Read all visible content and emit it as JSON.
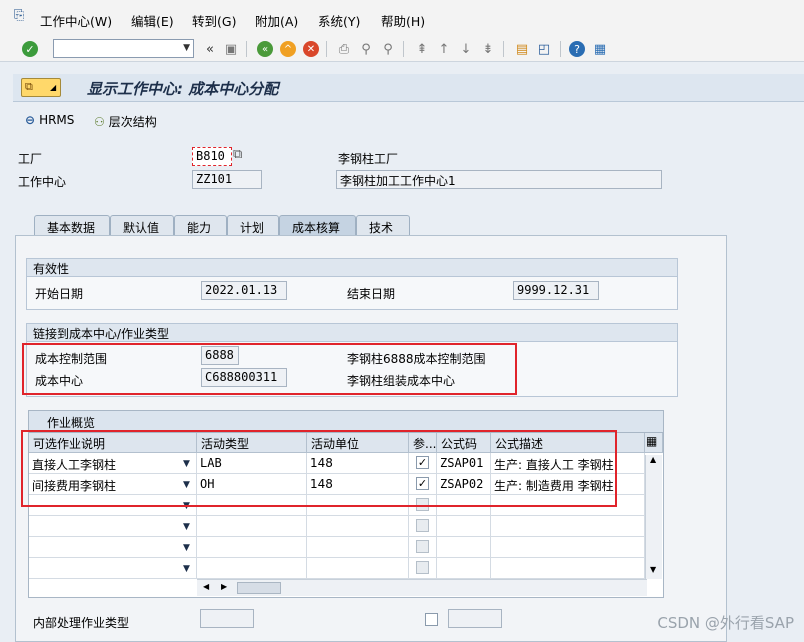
{
  "menu": [
    "工作中心(W)",
    "编辑(E)",
    "转到(G)",
    "附加(A)",
    "系统(Y)",
    "帮助(H)"
  ],
  "menu_underline": [
    "W",
    "E",
    "G",
    "A",
    "Y",
    "H"
  ],
  "title": "显示工作中心: 成本中心分配",
  "app_toolbar": {
    "hrms": "HRMS",
    "hierarchy": "层次结构"
  },
  "header": {
    "plant_label": "工厂",
    "plant_value": "B810",
    "plant_desc": "李钢柱工厂",
    "wc_label": "工作中心",
    "wc_value": "ZZ101",
    "wc_desc": "李钢柱加工工作中心1"
  },
  "tabs": [
    "基本数据",
    "默认值",
    "能力",
    "计划",
    "成本核算",
    "技术"
  ],
  "active_tab": "成本核算",
  "validity": {
    "title": "有效性",
    "start_label": "开始日期",
    "start_value": "2022.01.13",
    "end_label": "结束日期",
    "end_value": "9999.12.31"
  },
  "link": {
    "title": "链接到成本中心/作业类型",
    "ca_label": "成本控制范围",
    "ca_value": "6888",
    "ca_desc": "李钢柱6888成本控制范围",
    "cc_label": "成本中心",
    "cc_value": "C688800311",
    "cc_desc": "李钢柱组装成本中心"
  },
  "activity_table": {
    "title": "作业概览",
    "columns": [
      "可选作业说明",
      "活动类型",
      "活动单位",
      "参...",
      "公式码",
      "公式描述"
    ],
    "rows": [
      {
        "desc": "直接人工李钢柱",
        "type": "LAB",
        "unit": "148",
        "ref": true,
        "formula": "ZSAP01",
        "formula_desc": "生产: 直接人工 李钢柱"
      },
      {
        "desc": "间接费用李钢柱",
        "type": "OH",
        "unit": "148",
        "ref": true,
        "formula": "ZSAP02",
        "formula_desc": "生产: 制造费用 李钢柱"
      },
      {
        "desc": "",
        "type": "",
        "unit": "",
        "ref": false,
        "formula": "",
        "formula_desc": ""
      },
      {
        "desc": "",
        "type": "",
        "unit": "",
        "ref": false,
        "formula": "",
        "formula_desc": ""
      },
      {
        "desc": "",
        "type": "",
        "unit": "",
        "ref": false,
        "formula": "",
        "formula_desc": ""
      },
      {
        "desc": "",
        "type": "",
        "unit": "",
        "ref": false,
        "formula": "",
        "formula_desc": ""
      }
    ]
  },
  "internal": {
    "label": "内部处理作业类型"
  },
  "watermark": "CSDN @外行看SAP",
  "colors": {
    "highlight": "#e0242b",
    "title_button": "#ffd86a"
  }
}
